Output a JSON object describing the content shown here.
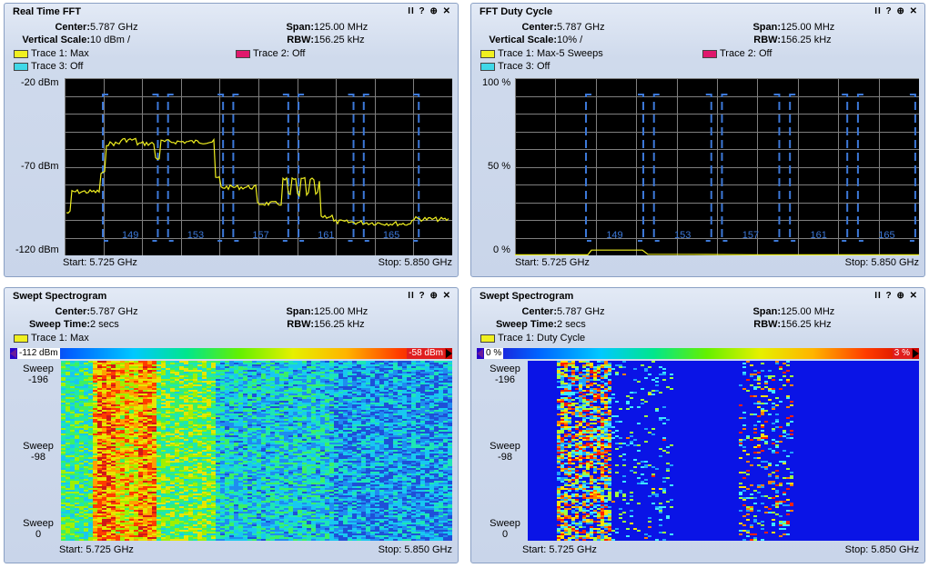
{
  "panels": {
    "tl": {
      "title": "Real Time FFT",
      "center_label": "Center:",
      "center_value": "5.787 GHz",
      "span_label": "Span:",
      "span_value": "125.00 MHz",
      "row2_label": "Vertical Scale:",
      "row2_value": "10 dBm /",
      "rbw_label": "RBW:",
      "rbw_value": "156.25 kHz",
      "trace1": "Trace 1: Max",
      "trace2": "Trace 2: Off",
      "trace3": "Trace 3: Off",
      "y_top": "-20 dBm",
      "y_mid": "-70 dBm",
      "y_bot": "-120 dBm",
      "start": "Start: 5.725 GHz",
      "stop": "Stop: 5.850 GHz",
      "channels": [
        "149",
        "153",
        "157",
        "161",
        "165"
      ]
    },
    "tr": {
      "title": "FFT Duty Cycle",
      "center_label": "Center:",
      "center_value": "5.787 GHz",
      "span_label": "Span:",
      "span_value": "125.00 MHz",
      "row2_label": "Vertical Scale:",
      "row2_value": "10% /",
      "rbw_label": "RBW:",
      "rbw_value": "156.25 kHz",
      "trace1": "Trace 1: Max-5 Sweeps",
      "trace2": "Trace 2: Off",
      "trace3": "Trace 3: Off",
      "y_top": "100 %",
      "y_mid": "50 %",
      "y_bot": "0 %",
      "start": "Start: 5.725 GHz",
      "stop": "Stop: 5.850 GHz",
      "channels": [
        "149",
        "153",
        "157",
        "161",
        "165"
      ]
    },
    "bl": {
      "title": "Swept Spectrogram",
      "center_label": "Center:",
      "center_value": "5.787 GHz",
      "span_label": "Span:",
      "span_value": "125.00 MHz",
      "row2_label": "Sweep Time:",
      "row2_value": "2 secs",
      "rbw_label": "RBW:",
      "rbw_value": "156.25 kHz",
      "trace1": "Trace 1: Max",
      "scale_min": "-112 dBm",
      "scale_max": "-58 dBm",
      "sweep_word": "Sweep",
      "sweep_top": "-196",
      "sweep_mid": "-98",
      "sweep_bot": "0",
      "start": "Start: 5.725 GHz",
      "stop": "Stop: 5.850 GHz"
    },
    "br": {
      "title": "Swept Spectrogram",
      "center_label": "Center:",
      "center_value": "5.787 GHz",
      "span_label": "Span:",
      "span_value": "125.00 MHz",
      "row2_label": "Sweep Time:",
      "row2_value": "2 secs",
      "rbw_label": "RBW:",
      "rbw_value": "156.25 kHz",
      "trace1": "Trace 1: Duty Cycle",
      "scale_min": "0 %",
      "scale_max": "3 %",
      "sweep_word": "Sweep",
      "sweep_top": "-196",
      "sweep_mid": "-98",
      "sweep_bot": "0",
      "start": "Start: 5.725 GHz",
      "stop": "Stop: 5.850 GHz"
    }
  },
  "controls": {
    "pause": "II",
    "help": "?",
    "zoom": "⊕",
    "close": "✕"
  },
  "colors": {
    "trace_yellow": "#f0f020",
    "trace_magenta": "#e0186c",
    "trace_cyan": "#40d8e8",
    "grid": "#7f7f7f",
    "channel_marker": "#3c78d8"
  },
  "icons": [
    "pause-icon",
    "help-icon",
    "zoom-icon",
    "close-icon"
  ]
}
